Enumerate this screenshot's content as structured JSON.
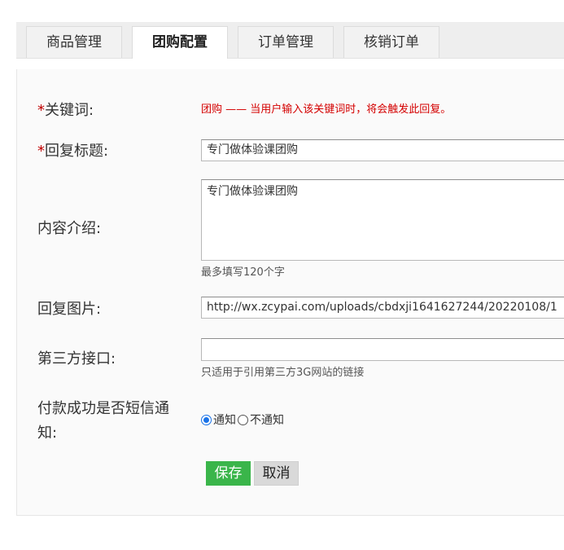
{
  "tabs": [
    {
      "label": "商品管理",
      "active": false
    },
    {
      "label": "团购配置",
      "active": true
    },
    {
      "label": "订单管理",
      "active": false
    },
    {
      "label": "核销订单",
      "active": false
    }
  ],
  "form": {
    "required_mark": "*",
    "keyword": {
      "label": "关键词:",
      "hint": "团购 —— 当用户输入该关键词时，将会触发此回复。"
    },
    "reply_title": {
      "label": "回复标题:",
      "value": "专门做体验课团购"
    },
    "content_intro": {
      "label": "内容介绍:",
      "value": "专门做体验课团购",
      "help": "最多填写120个字"
    },
    "reply_image": {
      "label": "回复图片:",
      "value": "http://wx.zcypai.com/uploads/cbdxji1641627244/20220108/1"
    },
    "third_party": {
      "label": "第三方接口:",
      "value": "",
      "help": "只适用于引用第三方3G网站的链接"
    },
    "sms_notify": {
      "label_line1": "付款成功是否短信通",
      "label_line2": "知:",
      "options": [
        {
          "label": "通知",
          "checked": true
        },
        {
          "label": "不通知",
          "checked": false
        }
      ]
    },
    "save_label": "保存",
    "cancel_label": "取消"
  },
  "colors": {
    "accent_green": "#3ab54a",
    "required_red": "#c00000",
    "hint_red": "#d40000"
  }
}
